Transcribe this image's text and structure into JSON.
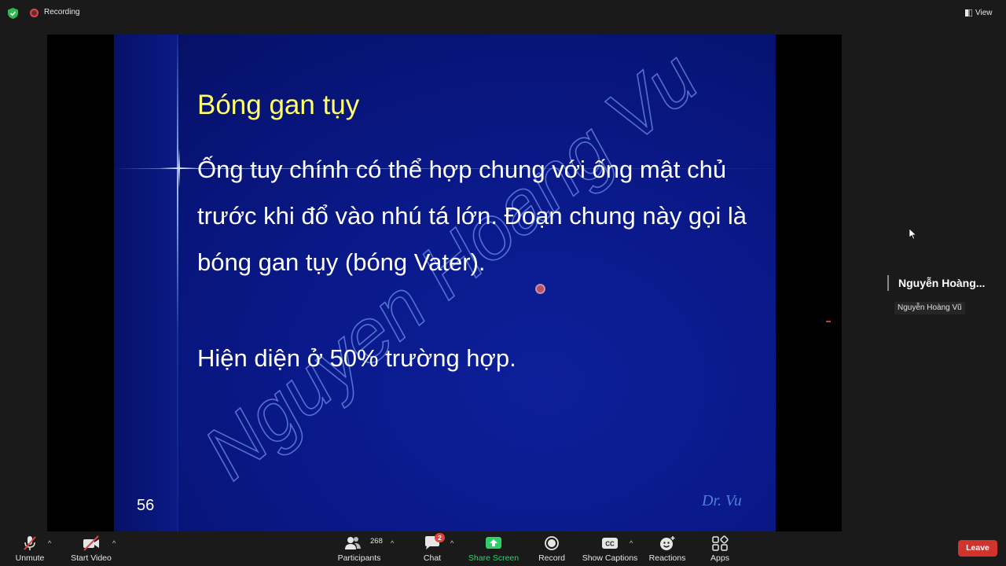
{
  "topbar": {
    "recording_label": "Recording",
    "view_label": "View"
  },
  "slide": {
    "title": "Bóng gan tụy",
    "body": "Ống tuy chính có thể hợp chung với ống mật chủ trước khi đổ vào nhú tá lớn. Đoạn chung này gọi là bóng gan tụy (bóng Vater).",
    "note": "Hiện diện ở 50% trường hợp.",
    "page_number": "56",
    "signature": "Dr. Vu",
    "watermark": "Nguyen Hoang Vu"
  },
  "participant": {
    "display_name": "Nguyễn Hoàng...",
    "name_tag": "Nguyễn Hoàng Vũ"
  },
  "toolbar": {
    "unmute_label": "Unmute",
    "start_video_label": "Start Video",
    "participants_label": "Participants",
    "participants_count": "268",
    "chat_label": "Chat",
    "chat_badge": "2",
    "share_screen_label": "Share Screen",
    "record_label": "Record",
    "captions_label": "Show Captions",
    "reactions_label": "Reactions",
    "apps_label": "Apps",
    "leave_label": "Leave"
  },
  "colors": {
    "accent_green": "#2fd06a",
    "leave_red": "#d0342c",
    "slide_title_yellow": "#ffff66",
    "slide_blue": "#0a1a8c"
  }
}
